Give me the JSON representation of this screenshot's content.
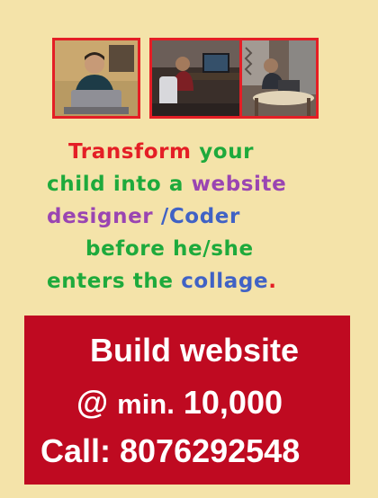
{
  "photos": [
    {
      "name": "photo-boy-at-laptop",
      "icon": "boy-with-laptop-photo"
    },
    {
      "name": "photo-boy-at-desk",
      "icon": "boy-at-computer-desk-photo"
    },
    {
      "name": "photo-boy-with-laptop-on-table",
      "icon": "boy-with-laptop-table-photo"
    }
  ],
  "headline": {
    "line1": {
      "word1": "Transform",
      "word2": "your"
    },
    "line2": {
      "part1": "child into a",
      "part2": "website"
    },
    "line3": {
      "part1": "designer",
      "part2": "/Coder"
    },
    "line4": {
      "text": "before he/she"
    },
    "line5": {
      "part1": "enters the",
      "part2": "collage",
      "part3": "."
    }
  },
  "banner": {
    "line1": "Build website",
    "line2_prefix": "@",
    "line2_small": "min.",
    "line2_value": "10,000",
    "line3": "Call: 8076292548"
  },
  "colors": {
    "background": "#f4e3a9",
    "red": "#e41e25",
    "green": "#1eaa3c",
    "purple": "#9a45b2",
    "blue": "#4062c5",
    "banner": "#bf0a21"
  }
}
